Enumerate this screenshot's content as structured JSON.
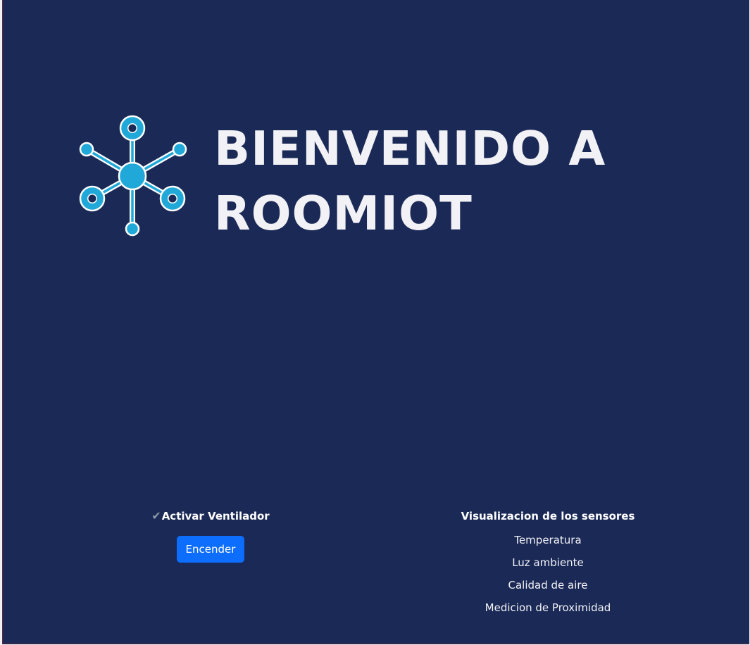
{
  "hero": {
    "title_line1": "BIENVENIDO A",
    "title_line2": "ROOMIOT",
    "logo_icon": "molecule-network-icon"
  },
  "fan": {
    "check_icon": "✔",
    "heading": "Activar Ventilador",
    "button_label": "Encender"
  },
  "sensors": {
    "heading": "Visualizacion de los sensores",
    "items": [
      "Temperatura",
      "Luz ambiente",
      "Calidad de aire",
      "Medicion de Proximidad"
    ]
  },
  "colors": {
    "background": "#1b2956",
    "accent_blue": "#0d6efd",
    "logo_cyan": "#1fa8d8",
    "text": "#f2f2f6"
  }
}
